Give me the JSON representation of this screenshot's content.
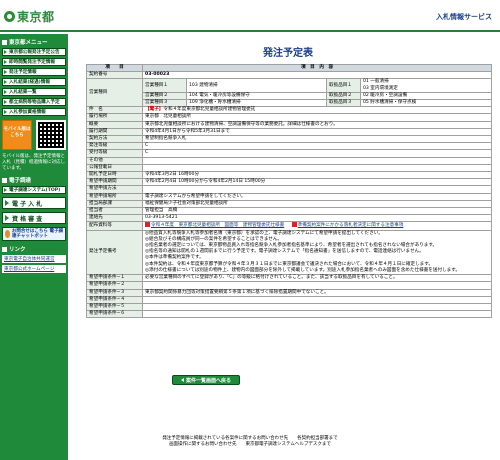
{
  "header": {
    "logo_text": "東京都",
    "service_title": "入札情報サービス"
  },
  "sidebar": {
    "section_menu": "東京都メニュー",
    "items": [
      "東京都公報発注予定公告",
      "即時閲覧発注予定情報",
      "発注予定情報",
      "入札結果(経過)情報",
      "入札結果一覧",
      "都立病院等物品購入予定",
      "入札参加資格情報"
    ],
    "mobile_label": "モバイル版はこちら",
    "mobile_note": "モバイル版は、発注予定情報と入札（見積）経過情報に対応しています。",
    "section_system": "電子調達",
    "system_items": [
      "電子調達システム(TOP)",
      "電 子 入 札",
      "資 格 審 査"
    ],
    "chat_label": "お問合せはこちら 電子調達チャットボット",
    "section_links": "リンク",
    "link_items": [
      "東京電子自治体共同運営",
      "東京都公式ホームページ"
    ]
  },
  "main": {
    "title": "発注予定表",
    "col_item": "項　　目",
    "col_content": "項　目　内　容",
    "rows": {
      "contract_no_label": "契約番号",
      "contract_no": "03-00023",
      "business_type_label": "営業種目",
      "bt1_label": "営業種目１",
      "bt1_value": "103 建物清掃",
      "bt2_label": "営業種目２",
      "bt2_value": "104 電気・暖冷房等設備保守",
      "bt3_label": "営業種目３",
      "bt3_value": "109 浄化槽・貯水槽清掃",
      "ti1_label": "取扱品目１",
      "ti1_value": "01 一般清掃\n03 室内環境測定",
      "ti2_label": "取扱品目２",
      "ti2_value": "02 暖冷房・空調設備",
      "ti3_label": "取扱品目３",
      "ti3_value": "05 貯水槽清掃・保守点検",
      "subject_label": "件　名",
      "subject_prefix": "【電子】",
      "subject_value": "令和４年度東京都北児童相談所建物管理委託",
      "location_label": "履行場所",
      "location_value": "東京都　北児童相談所",
      "summary_label": "概要",
      "summary_value": "東京都北児童相談所における建物清掃、空調設備保守等の業務委託。詳細は仕様書のとおり。",
      "period_label": "履行期間",
      "period_value": "令和4年4月1日から令和5年3月31日まで",
      "method_label": "契約方法",
      "method_value": "希望制指名競争入札",
      "ptype_label": "発注等級",
      "ptype_value": "C",
      "rtype_label": "受付等級",
      "rtype_value": "C",
      "other_label": "その他",
      "other_value": "",
      "pubdate_label": "公報登載日",
      "pubdate_value": "",
      "open_label": "開札予定日時",
      "open_value": "令和4年3月2日 16時00分",
      "apply_label": "希望申請期間",
      "apply_value": "令和4年2月4日 10時00分から令和4年2月14日 15時00分",
      "apply_method_label": "希望申請方法",
      "apply_method_value": "",
      "apply_place_label": "希望申請場所",
      "apply_place_value": "電子調達システムから希望申請をしてください。",
      "dept_label": "担当局部課",
      "dept_value": "福祉保健局少子社会対策部北児童相談所",
      "person_label": "担当者",
      "person_value": "管理担当　高橋",
      "contact_label": "連絡先",
      "contact_value": "03-3913-5421",
      "docs_label": "配布資料等",
      "doc1": "令和４年度　東京都北児童相談所　図面等　建物管理委託仕様書",
      "doc2": "準備契約案件にかかる落札者決定に関する注意事項",
      "notes_label": "発注予定備考",
      "notes_value": "◎他品質入札等競争入札等参加者名簿（東京都）を承認の上、電子調達システムにて希望申請を提出してください。\n◎組合及びその構成員が同一の案件を希望することはできません。\n◎指名業者の選定については、東京都物品買入れ等指名競争入札参加者指名基準により、希望者を選出されても指名されない場合があります。\n◎指名等の通知は開札の１週間前までに行う予定です。電子調達システムで「指名通知書」を送信しますので、電話連絡は行いません。\n◎本件は準備契約案件です。\n◎本件契約は、令和４年度東京都予算が令和４年３月３１日までに東京都議会で議決された場合において、令和４年４月１日に確定します。\n◎添付の仕様書については別途の物件上、建物内の図面部分を除外して掲載しています。別途入札参加指名業者へのみ図面を含めた仕様書を送付します。",
      "cond1_label": "希望申請条件−１",
      "cond1_value": "必要な営業種目のすべてに登録があり、「C」の等級に格付けされていること。また、該当する取扱品目を有していること。",
      "cond2_label": "希望申請条件−２",
      "cond2_value": "",
      "cond3_label": "希望申請条件−３",
      "cond3_value": "東京都契約関係暴力団等対策措置要綱第５条第１項に基づく排除措置期間中でないこと。",
      "cond4_label": "希望申請条件−４",
      "cond4_value": "",
      "cond5_label": "希望申請条件−５",
      "cond5_value": "",
      "cond6_label": "希望申請条件−６",
      "cond6_value": ""
    },
    "back_button": "案件一覧画面へ戻る"
  },
  "footer": {
    "line1": "発注予定情報に掲載されている各案件に関するお問い合わせ先　　各契約担当部署まで",
    "line2": "画面操作に関するお問い合わせ先　　東京都電子調達システムヘルプデスクまで"
  },
  "colors": {
    "brand_green": "#1f8a3a",
    "title_blue": "#1a3e8a",
    "label_bg": "#e6efe6"
  }
}
